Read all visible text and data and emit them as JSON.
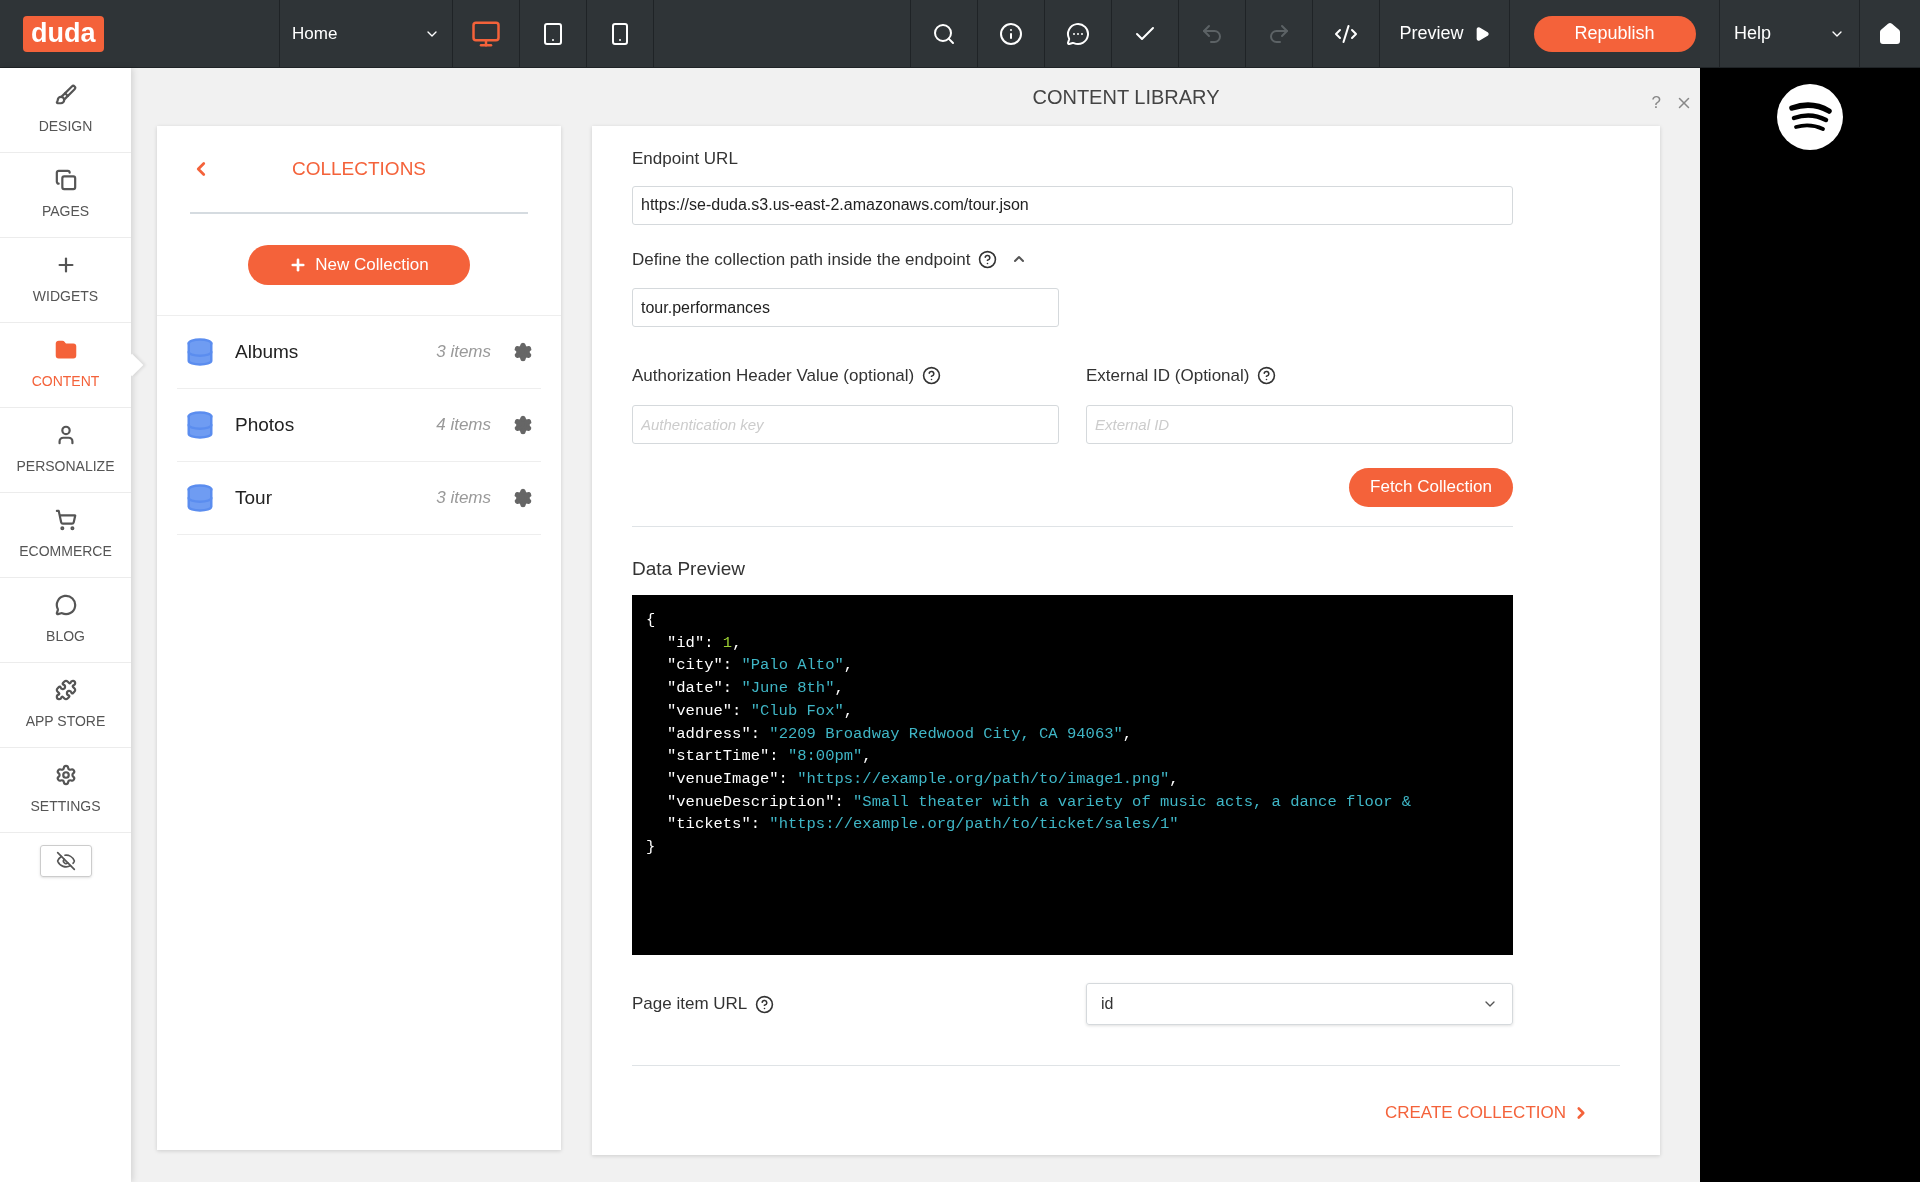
{
  "topbar": {
    "logo": "duda",
    "page_select": {
      "value": "Home"
    },
    "devices": [
      {
        "kind": "desktop",
        "selected": true
      },
      {
        "kind": "tablet",
        "selected": false
      },
      {
        "kind": "phone",
        "selected": false
      }
    ],
    "tools": [
      {
        "kind": "search",
        "disabled": false
      },
      {
        "kind": "info",
        "disabled": false
      },
      {
        "kind": "comment",
        "disabled": false
      },
      {
        "kind": "check",
        "disabled": false
      },
      {
        "kind": "undo",
        "disabled": true
      },
      {
        "kind": "redo",
        "disabled": true
      },
      {
        "kind": "code",
        "disabled": false
      }
    ],
    "preview": "Preview",
    "republish": "Republish",
    "help": "Help"
  },
  "sidebar": {
    "items": [
      {
        "kind": "design",
        "label": "DESIGN",
        "selected": false
      },
      {
        "kind": "pages",
        "label": "PAGES",
        "selected": false
      },
      {
        "kind": "widgets",
        "label": "WIDGETS",
        "selected": false
      },
      {
        "kind": "content",
        "label": "CONTENT",
        "selected": true
      },
      {
        "kind": "personalize",
        "label": "PERSONALIZE",
        "selected": false
      },
      {
        "kind": "ecommerce",
        "label": "ECOMMERCE",
        "selected": false
      },
      {
        "kind": "blog",
        "label": "BLOG",
        "selected": false
      },
      {
        "kind": "appstore",
        "label": "APP STORE",
        "selected": false
      },
      {
        "kind": "settings",
        "label": "SETTINGS",
        "selected": false
      }
    ]
  },
  "content_library": {
    "title": "CONTENT LIBRARY",
    "help": "?",
    "collections": {
      "title": "COLLECTIONS",
      "new_button": "New Collection",
      "items": [
        {
          "name": "Albums",
          "count": "3 items"
        },
        {
          "name": "Photos",
          "count": "4 items"
        },
        {
          "name": "Tour",
          "count": "3 items"
        }
      ]
    },
    "form": {
      "endpoint": {
        "label": "Endpoint URL",
        "value": "https://se-duda.s3.us-east-2.amazonaws.com/tour.json"
      },
      "path": {
        "label": "Define the collection path inside the endpoint",
        "expanded": true,
        "value": "tour.performances"
      },
      "auth": {
        "label": "Authorization Header Value (optional)",
        "placeholder": "Authentication key"
      },
      "external_id": {
        "label": "External ID (Optional)",
        "placeholder": "External ID"
      },
      "fetch_button": "Fetch Collection",
      "preview_title": "Data Preview",
      "preview_lines": [
        [
          {
            "kind": "punct",
            "text": "{"
          }
        ],
        [
          {
            "kind": "key",
            "text": "\"id\": "
          },
          {
            "kind": "number",
            "text": "1"
          },
          {
            "kind": "punct",
            "text": ","
          }
        ],
        [
          {
            "kind": "key",
            "text": "\"city\": "
          },
          {
            "kind": "string",
            "text": "\"Palo Alto\""
          },
          {
            "kind": "punct",
            "text": ","
          }
        ],
        [
          {
            "kind": "key",
            "text": "\"date\": "
          },
          {
            "kind": "string",
            "text": "\"June 8th\""
          },
          {
            "kind": "punct",
            "text": ","
          }
        ],
        [
          {
            "kind": "key",
            "text": "\"venue\": "
          },
          {
            "kind": "string",
            "text": "\"Club Fox\""
          },
          {
            "kind": "punct",
            "text": ","
          }
        ],
        [
          {
            "kind": "key",
            "text": "\"address\": "
          },
          {
            "kind": "string",
            "text": "\"2209 Broadway Redwood City, CA 94063\""
          },
          {
            "kind": "punct",
            "text": ","
          }
        ],
        [
          {
            "kind": "key",
            "text": "\"startTime\": "
          },
          {
            "kind": "string",
            "text": "\"8:00pm\""
          },
          {
            "kind": "punct",
            "text": ","
          }
        ],
        [
          {
            "kind": "key",
            "text": "\"venueImage\": "
          },
          {
            "kind": "string",
            "text": "\"https://example.org/path/to/image1.png\""
          },
          {
            "kind": "punct",
            "text": ","
          }
        ],
        [
          {
            "kind": "key",
            "text": "\"venueDescription\": "
          },
          {
            "kind": "string",
            "text": "\"Small theater with a variety of music acts, a dance floor &"
          }
        ],
        [
          {
            "kind": "key",
            "text": "\"tickets\": "
          },
          {
            "kind": "string",
            "text": "\"https://example.org/path/to/ticket/sales/1\""
          }
        ],
        [
          {
            "kind": "punct",
            "text": "}"
          }
        ]
      ],
      "page_item_url": {
        "label": "Page item URL",
        "value": "id"
      },
      "create_button": "CREATE COLLECTION"
    }
  }
}
